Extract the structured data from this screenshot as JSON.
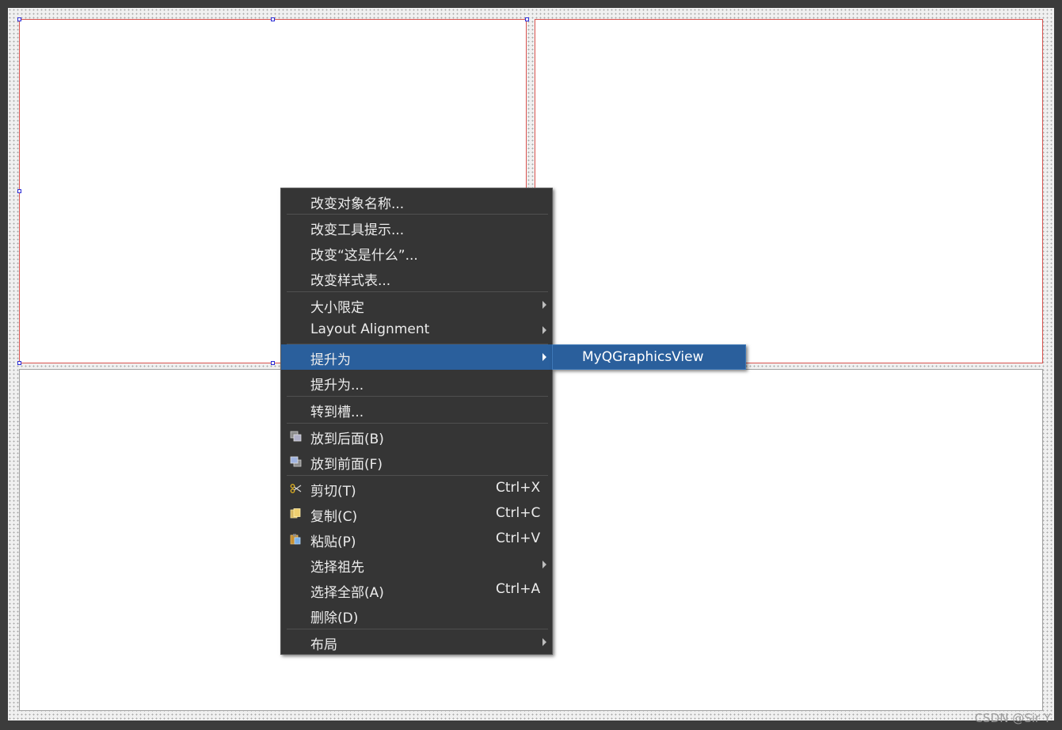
{
  "context_menu": {
    "items": [
      {
        "label": "改变对象名称..."
      },
      {
        "label": "改变工具提示..."
      },
      {
        "label": "改变“这是什么”..."
      },
      {
        "label": "改变样式表..."
      },
      {
        "label": "大小限定"
      },
      {
        "label": "Layout Alignment"
      },
      {
        "label": "提升为"
      },
      {
        "label": "提升为..."
      },
      {
        "label": "转到槽..."
      },
      {
        "label": "放到后面(B)"
      },
      {
        "label": "放到前面(F)"
      },
      {
        "label": "剪切(T)",
        "shortcut": "Ctrl+X"
      },
      {
        "label": "复制(C)",
        "shortcut": "Ctrl+C"
      },
      {
        "label": "粘贴(P)",
        "shortcut": "Ctrl+V"
      },
      {
        "label": "选择祖先"
      },
      {
        "label": "选择全部(A)",
        "shortcut": "Ctrl+A"
      },
      {
        "label": "删除(D)"
      },
      {
        "label": "布局"
      }
    ]
  },
  "submenu": {
    "items": [
      {
        "label": "MyQGraphicsView"
      }
    ]
  },
  "colors": {
    "menu_bg": "#353535",
    "highlight": "#2a5f9c",
    "selection_border": "#d9534f",
    "handle": "#2b2bd6"
  },
  "watermark": "CSDN @Sir Y"
}
